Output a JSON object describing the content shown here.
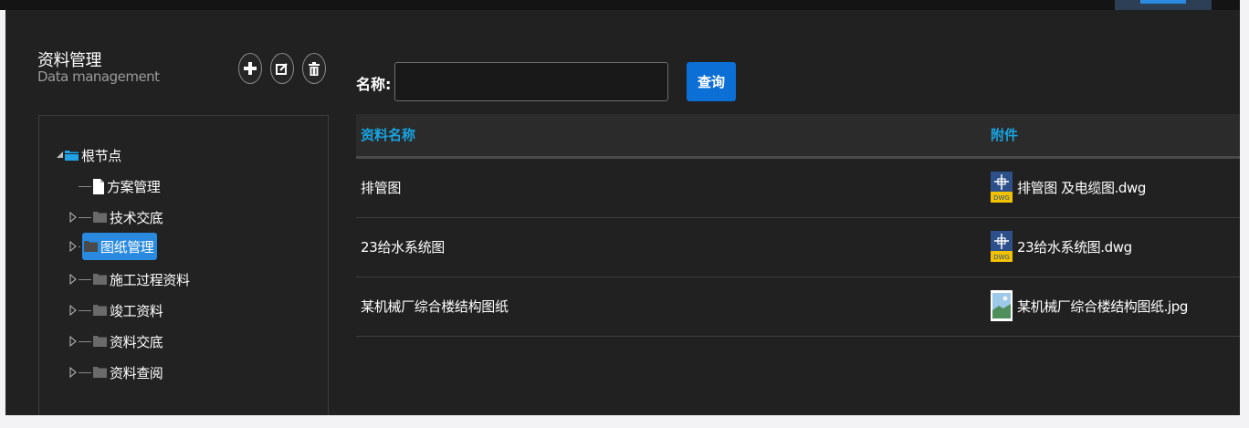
{
  "header": {
    "title": "资料管理",
    "subtitle": "Data management"
  },
  "toolbar": {
    "add_icon": "plus-icon",
    "edit_icon": "edit-icon",
    "delete_icon": "trash-icon"
  },
  "tree": {
    "root": {
      "label": "根节点",
      "expanded": true,
      "icon": "open-folder-icon"
    },
    "children": [
      {
        "label": "方案管理",
        "icon": "document-icon",
        "has_children": false,
        "selected": false
      },
      {
        "label": "技术交底",
        "icon": "folder-icon",
        "has_children": true,
        "selected": false
      },
      {
        "label": "图纸管理",
        "icon": "folder-icon",
        "has_children": true,
        "selected": true
      },
      {
        "label": "施工过程资料",
        "icon": "folder-icon",
        "has_children": true,
        "selected": false
      },
      {
        "label": "竣工资料",
        "icon": "folder-icon",
        "has_children": true,
        "selected": false
      },
      {
        "label": "资料交底",
        "icon": "folder-icon",
        "has_children": true,
        "selected": false
      },
      {
        "label": "资料查阅",
        "icon": "folder-icon",
        "has_children": true,
        "selected": false
      }
    ]
  },
  "search": {
    "label": "名称:",
    "value": "",
    "placeholder": "",
    "button_label": "查询"
  },
  "table": {
    "columns": [
      "资料名称",
      "附件"
    ],
    "rows": [
      {
        "name": "排管图",
        "attachment": "排管图 及电缆图.dwg",
        "file_icon": "dwg-file-icon"
      },
      {
        "name": "23给水系统图",
        "attachment": "23给水系统图.dwg",
        "file_icon": "dwg-file-icon"
      },
      {
        "name": "某机械厂综合楼结构图纸",
        "attachment": "某机械厂综合楼结构图纸.jpg",
        "file_icon": "jpg-file-icon"
      }
    ]
  },
  "colors": {
    "accent": "#0b6fd6",
    "selection": "#2a8ae0",
    "header_text": "#18a3e0",
    "panel_bg": "#212121"
  }
}
